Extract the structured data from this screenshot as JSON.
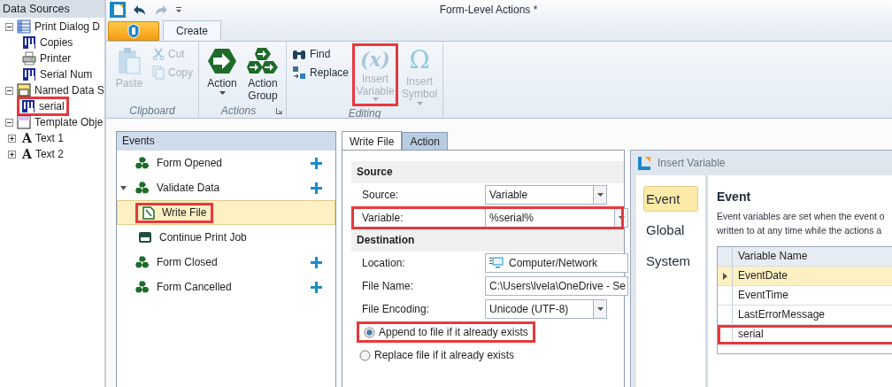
{
  "data_sources": {
    "title": "Data Sources",
    "tree": [
      {
        "label": "Print Dialog D",
        "kind": "table",
        "expanded": true,
        "highlighted": false,
        "children": [
          {
            "label": "Copies",
            "kind": "variable",
            "highlighted": false
          },
          {
            "label": "Printer",
            "kind": "printer",
            "highlighted": false
          },
          {
            "label": "Serial Num",
            "kind": "variable",
            "highlighted": false
          }
        ]
      },
      {
        "label": "Named Data S",
        "kind": "named",
        "expanded": true,
        "highlighted": false,
        "children": [
          {
            "label": "serial",
            "kind": "variable",
            "highlighted": true
          }
        ]
      },
      {
        "label": "Template Obje",
        "kind": "template",
        "expanded": true,
        "highlighted": false,
        "children": [
          {
            "label": "Text 1",
            "kind": "text",
            "icon_char": "A",
            "expanded": false,
            "highlighted": false
          },
          {
            "label": "Text 2",
            "kind": "text",
            "icon_char": "A",
            "expanded": false,
            "highlighted": false
          }
        ]
      }
    ]
  },
  "window": {
    "title": "Form-Level Actions *"
  },
  "ribbon": {
    "tabs": [
      {
        "label": "Create",
        "selected": true
      }
    ],
    "groups": [
      {
        "label": "Clipboard",
        "buttons": [
          {
            "label": "Paste",
            "kind": "paste",
            "disabled": true,
            "highlighted": false
          },
          {
            "label": "Cut",
            "kind": "cut",
            "disabled": true,
            "highlighted": false
          },
          {
            "label": "Copy",
            "kind": "copy",
            "disabled": true,
            "highlighted": false
          }
        ]
      },
      {
        "label": "Actions",
        "launcher": true,
        "buttons": [
          {
            "label": "Action",
            "kind": "action",
            "dropdown": true,
            "disabled": false,
            "highlighted": false
          },
          {
            "label": "Action Group",
            "kind": "group",
            "disabled": false,
            "highlighted": false
          }
        ]
      },
      {
        "label": "Editing",
        "buttons": [
          {
            "label": "Find",
            "kind": "find",
            "disabled": false,
            "highlighted": false
          },
          {
            "label": "Replace",
            "kind": "replace",
            "disabled": false,
            "highlighted": false
          },
          {
            "label": "Insert Variable",
            "kind": "variable",
            "icon_text": "(x)",
            "dropdown": true,
            "disabled": true,
            "highlighted": true
          },
          {
            "label": "Insert Symbol",
            "kind": "symbol",
            "icon_text": "Ω",
            "dropdown": true,
            "disabled": true,
            "highlighted": false
          }
        ]
      }
    ]
  },
  "events": {
    "title": "Events",
    "items": [
      {
        "label": "Form Opened",
        "kind": "event",
        "can_add": true,
        "selected": false,
        "highlighted": false
      },
      {
        "label": "Validate Data",
        "kind": "event",
        "can_add": true,
        "expanded": true,
        "selected": false,
        "highlighted": false,
        "children": [
          {
            "label": "Write File",
            "kind": "write",
            "selected": true,
            "highlighted": true
          },
          {
            "label": "Continue Print Job",
            "kind": "print",
            "selected": false,
            "highlighted": false
          }
        ]
      },
      {
        "label": "Form Closed",
        "kind": "event",
        "can_add": true,
        "selected": false,
        "highlighted": false
      },
      {
        "label": "Form Cancelled",
        "kind": "event",
        "can_add": true,
        "selected": false,
        "highlighted": false
      }
    ]
  },
  "properties": {
    "tabs": [
      {
        "label": "Write File",
        "selected": true
      },
      {
        "label": "Action",
        "selected": false
      }
    ],
    "sections": [
      {
        "title": "Source",
        "fields": [
          {
            "label": "Source:",
            "value": "Variable",
            "kind": "dropdown",
            "wide": false,
            "highlighted": false
          },
          {
            "label": "Variable:",
            "value": "%serial%",
            "kind": "dropdown",
            "wide": true,
            "highlighted": true
          }
        ]
      },
      {
        "title": "Destination",
        "fields": [
          {
            "label": "Location:",
            "value": "Computer/Network",
            "kind": "location",
            "wide": true,
            "highlighted": false
          },
          {
            "label": "File Name:",
            "value": "C:\\Users\\lvela\\OneDrive - Se",
            "kind": "text",
            "wide": true,
            "highlighted": false
          },
          {
            "label": "File Encoding:",
            "value": "Unicode (UTF-8)",
            "kind": "dropdown",
            "wide": false,
            "highlighted": false
          }
        ]
      }
    ],
    "options": [
      {
        "label": "Append to file if it already exists",
        "selected": true,
        "highlighted": true
      },
      {
        "label": "Replace file if it already exists",
        "selected": false,
        "highlighted": false
      }
    ]
  },
  "dialog": {
    "title": "Insert Variable",
    "nav": [
      {
        "label": "Event",
        "selected": true
      },
      {
        "label": "Global",
        "selected": false
      },
      {
        "label": "System",
        "selected": false
      }
    ],
    "heading": "Event",
    "description": [
      "Event variables are set when the event o",
      "written to at any time while the actions a"
    ],
    "table": {
      "columns": [
        "Variable Name"
      ],
      "rows": [
        {
          "name": "EventDate",
          "selected": true,
          "highlighted": false
        },
        {
          "name": "EventTime",
          "selected": false,
          "highlighted": false
        },
        {
          "name": "LastErrorMessage",
          "selected": false,
          "highlighted": false
        },
        {
          "name": "serial",
          "selected": false,
          "highlighted": true
        }
      ]
    }
  }
}
